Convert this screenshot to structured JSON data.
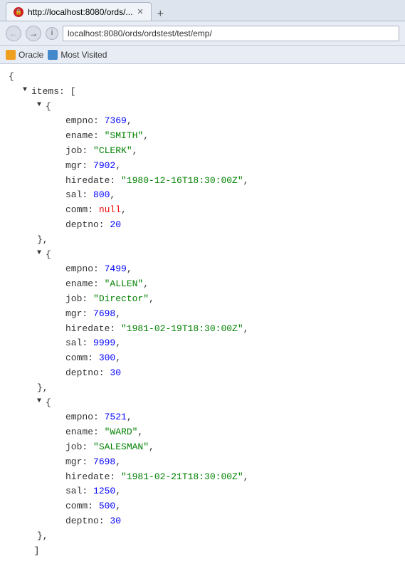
{
  "browser": {
    "tab_title": "http://localhost:8080/ords/...",
    "url": "localhost:8080/ords/ordstest/test/emp/",
    "oracle_bookmark": "Oracle",
    "most_visited_bookmark": "Most Visited"
  },
  "json_data": {
    "items": [
      {
        "empno": 7369,
        "ename": "SMITH",
        "job": "CLERK",
        "mgr": 7902,
        "hiredate": "1980-12-16T18:30:00Z",
        "sal": 800,
        "comm": null,
        "deptno": 20
      },
      {
        "empno": 7499,
        "ename": "ALLEN",
        "job": "Director",
        "mgr": 7698,
        "hiredate": "1981-02-19T18:30:00Z",
        "sal": 9999,
        "comm": 300,
        "deptno": 30
      },
      {
        "empno": 7521,
        "ename": "WARD",
        "job": "SALESMAN",
        "mgr": 7698,
        "hiredate": "1981-02-21T18:30:00Z",
        "sal": 1250,
        "comm": 500,
        "deptno": 30
      }
    ]
  }
}
